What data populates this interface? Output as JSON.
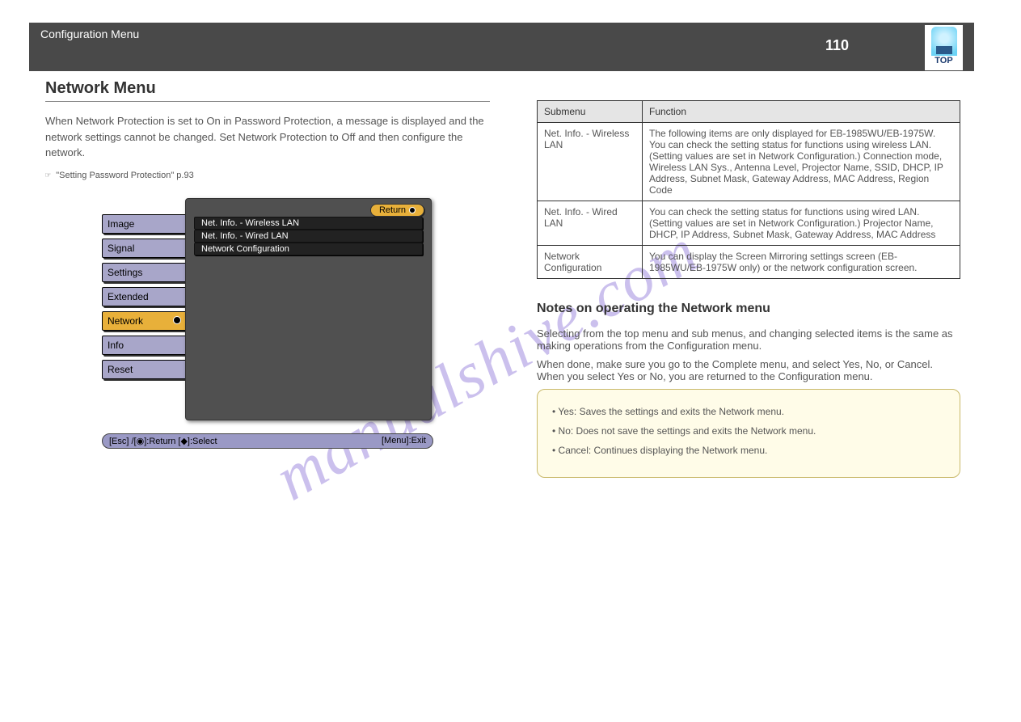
{
  "header": {
    "title": "Configuration Menu",
    "page_number": "110",
    "top_label": "TOP"
  },
  "left": {
    "section_title": "Network Menu",
    "para1": "When Network Protection is set to On in Password Protection, a message is displayed and the network settings cannot be changed. Set Network Protection to Off and then configure the network.",
    "cross_ref1": "\"Setting Password Protection\" p.93",
    "screenshot": {
      "tabs": [
        "Image",
        "Signal",
        "Settings",
        "Extended",
        "Network",
        "Info",
        "Reset"
      ],
      "active_tab": "Network",
      "return_label": "Return",
      "items": [
        "Net. Info. - Wireless LAN",
        "Net. Info. - Wired LAN",
        "Network Configuration"
      ],
      "footer_left": "[Esc] /[◉]:Return  [◆]:Select",
      "footer_right": "[Menu]:Exit"
    }
  },
  "right": {
    "table": {
      "header": [
        "Submenu",
        "Function"
      ],
      "rows": [
        {
          "c1": "Net. Info. - Wireless LAN",
          "c2": "The following items are only displayed for EB-1985WU/EB-1975W.\nYou can check the setting status for functions using wireless LAN. (Setting values are set in Network Configuration.)\nConnection mode, Wireless LAN Sys., Antenna Level, Projector Name, SSID, DHCP, IP Address, Subnet Mask, Gateway Address, MAC Address, Region Code"
        },
        {
          "c1": "Net. Info. - Wired LAN",
          "c2": "You can check the setting status for functions using wired LAN. (Setting values are set in Network Configuration.)\nProjector Name, DHCP, IP Address, Subnet Mask, Gateway Address, MAC Address"
        },
        {
          "c1": "Network Configuration",
          "c2": "You can display the Screen Mirroring settings screen (EB-1985WU/EB-1975W only) or the network configuration screen."
        }
      ]
    },
    "notes_title": "Notes on operating the Network menu",
    "notes_sub": "Selecting from the top menu and sub menus, and changing selected items is the same as making operations from the Configuration menu.",
    "notes_sub2": "When done, make sure you go to the Complete menu, and select Yes, No, or Cancel. When you select Yes or No, you are returned to the Configuration menu.",
    "note_box": {
      "line1": "• Yes: Saves the settings and exits the Network menu.",
      "line2": "• No: Does not save the settings and exits the Network menu.",
      "line3": "• Cancel: Continues displaying the Network menu."
    }
  },
  "watermark": "manualshive.com"
}
